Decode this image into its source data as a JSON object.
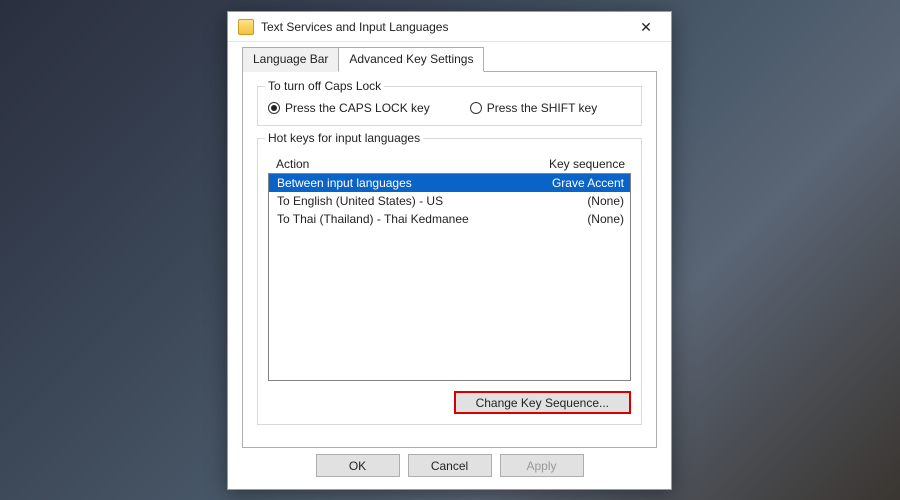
{
  "window": {
    "title": "Text Services and Input Languages",
    "close_glyph": "✕"
  },
  "tabs": [
    {
      "label": "Language Bar",
      "active": false
    },
    {
      "label": "Advanced Key Settings",
      "active": true
    }
  ],
  "caps_group": {
    "title": "To turn off Caps Lock",
    "options": [
      {
        "label": "Press the CAPS LOCK key",
        "checked": true
      },
      {
        "label": "Press the SHIFT key",
        "checked": false
      }
    ]
  },
  "hotkeys_group": {
    "title": "Hot keys for input languages",
    "headers": {
      "action": "Action",
      "sequence": "Key sequence"
    },
    "rows": [
      {
        "action": "Between input languages",
        "sequence": "Grave Accent",
        "selected": true
      },
      {
        "action": "To English (United States) - US",
        "sequence": "(None)",
        "selected": false
      },
      {
        "action": "To Thai (Thailand) - Thai Kedmanee",
        "sequence": "(None)",
        "selected": false
      }
    ],
    "change_btn": "Change Key Sequence..."
  },
  "footer": {
    "ok": "OK",
    "cancel": "Cancel",
    "apply": "Apply"
  }
}
